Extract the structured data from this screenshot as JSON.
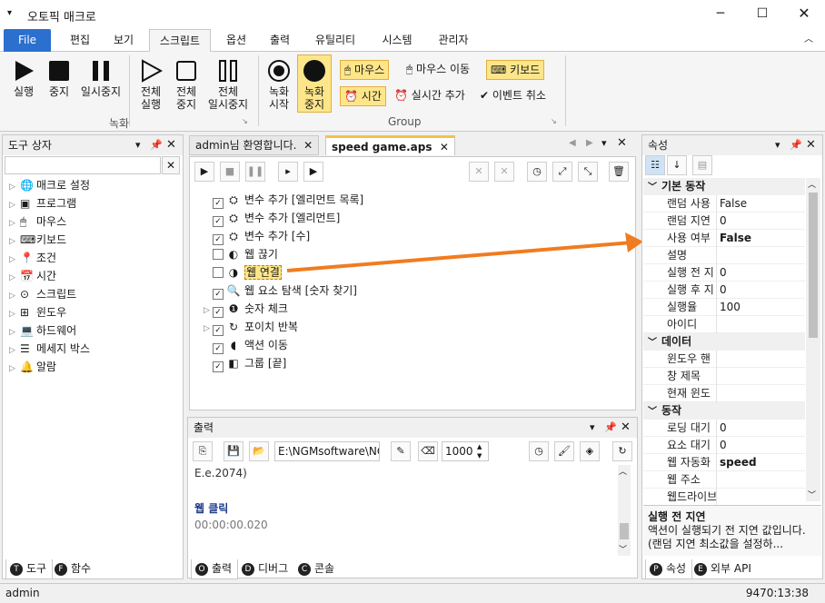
{
  "app": {
    "title": "오토픽 매크로"
  },
  "menu": {
    "file": "File",
    "items": [
      "편집",
      "보기",
      "스크립트",
      "옵션",
      "출력",
      "유틸리티",
      "시스템",
      "관리자"
    ]
  },
  "ribbon": {
    "run": "실행",
    "stop": "중지",
    "pause": "일시중지",
    "all_run": [
      "전체",
      "실행"
    ],
    "all_stop": [
      "전체",
      "중지"
    ],
    "all_pause": [
      "전체",
      "일시중지"
    ],
    "rec_start": [
      "녹화",
      "시작"
    ],
    "rec_stop": [
      "녹화",
      "중지"
    ],
    "mouse": "마우스",
    "mouse_move": "마우스 이동",
    "keyboard": "키보드",
    "time": "시간",
    "realtime_add": "실시간 추가",
    "event_cancel": "이벤트 취소",
    "group_record": "녹화",
    "group_group": "Group"
  },
  "toolbox": {
    "title": "도구 상자",
    "items": [
      "매크로 설정",
      "프로그램",
      "마우스",
      "키보드",
      "조건",
      "시간",
      "스크립트",
      "윈도우",
      "하드웨어",
      "메세지 박스",
      "알람"
    ],
    "icons": [
      "globe-gear-icon",
      "program-icon",
      "mouse-icon",
      "keyboard-icon",
      "location-pin-icon",
      "calendar-icon",
      "script-icon",
      "windows-icon",
      "laptop-icon",
      "message-box-icon",
      "bell-icon"
    ],
    "tabs": [
      {
        "badge": "T",
        "label": "도구"
      },
      {
        "badge": "F",
        "label": "함수"
      }
    ]
  },
  "documents": {
    "tabs": [
      "admin님 환영합니다.",
      "speed game.aps"
    ],
    "actions": [
      {
        "label": "변수 추가 [엘리먼트 목록]",
        "checked": true,
        "expandable": false
      },
      {
        "label": "변수 추가 [엘리먼트]",
        "checked": true,
        "expandable": false
      },
      {
        "label": "변수 추가 [수]",
        "checked": true,
        "expandable": false
      },
      {
        "label": "웹 끊기",
        "checked": false,
        "expandable": false
      },
      {
        "label": "웹 연결",
        "checked": false,
        "expandable": false,
        "selected": true
      },
      {
        "label": "웹 요소 탐색 [숫자 찾기]",
        "checked": true,
        "expandable": false
      },
      {
        "label": "숫자 체크",
        "checked": true,
        "expandable": true
      },
      {
        "label": "포이치 반복",
        "checked": true,
        "expandable": true
      },
      {
        "label": "액션 이동",
        "checked": true,
        "expandable": false
      },
      {
        "label": "그룹 [끝]",
        "checked": true,
        "expandable": false
      }
    ]
  },
  "output": {
    "title": "출력",
    "path": "E:\\NGMsoftware\\NG",
    "interval": "1000",
    "lines": [
      "E.e.2074)",
      "",
      "웹 클릭",
      "00:00:00.020"
    ],
    "tabs": [
      {
        "badge": "O",
        "label": "출력"
      },
      {
        "badge": "D",
        "label": "디버그"
      },
      {
        "badge": "C",
        "label": "콘솔"
      }
    ]
  },
  "properties": {
    "title": "속성",
    "categories": [
      {
        "name": "기본 동작",
        "rows": [
          {
            "k": "랜덤 사용",
            "v": "False",
            "bold": false
          },
          {
            "k": "랜덤 지연",
            "v": "0",
            "bold": false
          },
          {
            "k": "사용 여부",
            "v": "False",
            "bold": true
          },
          {
            "k": "설명",
            "v": "",
            "bold": false
          },
          {
            "k": "실행 전 지",
            "v": "0",
            "bold": false
          },
          {
            "k": "실행 후 지",
            "v": "0",
            "bold": false
          },
          {
            "k": "실행율",
            "v": "100",
            "bold": false
          },
          {
            "k": "아이디",
            "v": "",
            "bold": false
          }
        ]
      },
      {
        "name": "데이터",
        "rows": [
          {
            "k": "윈도우 핸",
            "v": "",
            "bold": false
          },
          {
            "k": "창 제목",
            "v": "",
            "bold": false
          },
          {
            "k": "현재 윈도",
            "v": "",
            "bold": false
          }
        ]
      },
      {
        "name": "동작",
        "rows": [
          {
            "k": "로딩 대기",
            "v": "0",
            "bold": false
          },
          {
            "k": "요소 대기",
            "v": "0",
            "bold": false
          },
          {
            "k": "웹 자동화",
            "v": "speed",
            "bold": true
          },
          {
            "k": "웹 주소",
            "v": "",
            "bold": false
          },
          {
            "k": "웹드라이브",
            "v": "",
            "bold": false
          }
        ]
      }
    ],
    "desc_title": "실행 전 지연",
    "desc_text": "액션이 실행되기 전 지연 값입니다. (랜덤 지연 최소값을 설정하...",
    "tabs": [
      {
        "badge": "P",
        "label": "속성"
      },
      {
        "badge": "E",
        "label": "외부 API"
      }
    ]
  },
  "status": {
    "user": "admin",
    "time": "9470:13:38"
  },
  "colors": {
    "accent": "#2b6fcf",
    "highlight": "#fde68a",
    "arrow": "#f07c20"
  }
}
